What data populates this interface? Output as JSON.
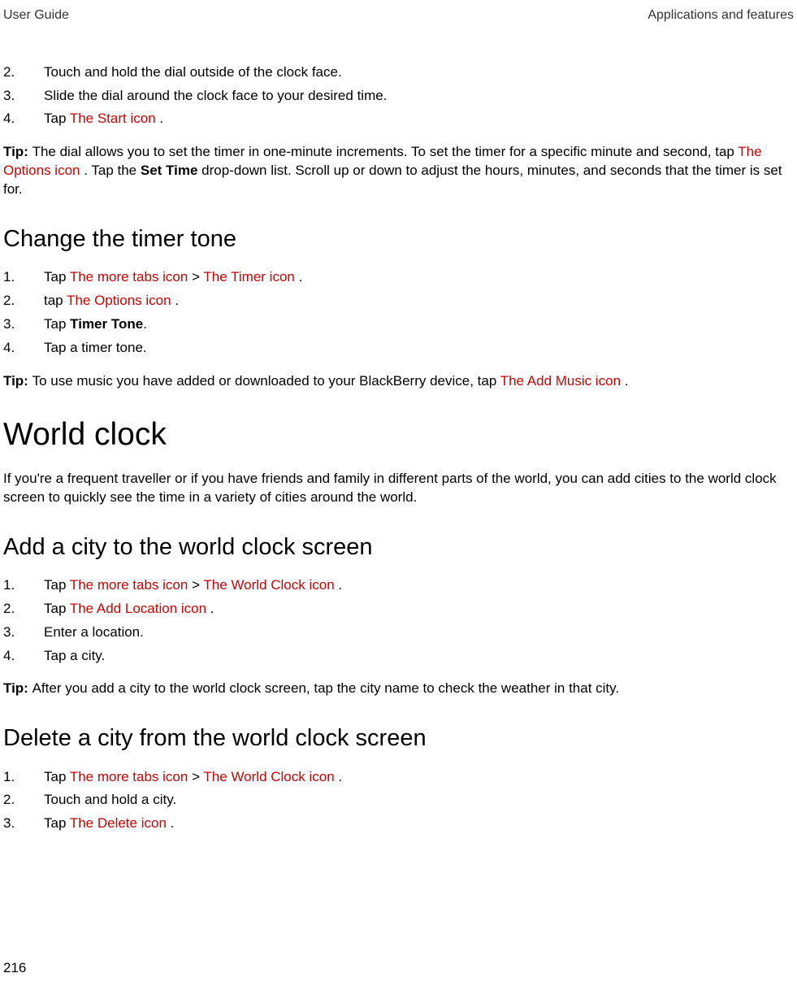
{
  "header": {
    "left": "User Guide",
    "right": "Applications and features"
  },
  "list1": {
    "i1": {
      "num": "2.",
      "text": "Touch and hold the dial outside of the clock face."
    },
    "i2": {
      "num": "3.",
      "text": "Slide the dial around the clock face to your desired time."
    },
    "i3": {
      "num": "4.",
      "pre": "Tap ",
      "icon": " The Start icon ",
      "post": "."
    }
  },
  "tip1": {
    "label": "Tip: ",
    "a": "The dial allows you to set the timer in one-minute increments. To set the timer for a specific minute and second, tap ",
    "icon": " The Options icon ",
    "b": ". Tap the ",
    "bold": "Set Time",
    "c": " drop-down list. Scroll up or down to adjust the hours, minutes, and seconds that the timer is set for."
  },
  "h_timer_tone": "Change the timer tone",
  "list2": {
    "i1": {
      "num": "1.",
      "pre": "Tap ",
      "icon1": " The more tabs icon ",
      "sep": " > ",
      "icon2": " The Timer icon ",
      "post": "."
    },
    "i2": {
      "num": "2.",
      "pre": "tap ",
      "icon": " The Options icon ",
      "post": "."
    },
    "i3": {
      "num": "3.",
      "pre": "Tap ",
      "bold": "Timer Tone",
      "post": "."
    },
    "i4": {
      "num": "4.",
      "text": "Tap a timer tone."
    }
  },
  "tip2": {
    "label": "Tip: ",
    "a": "To use music you have added or downloaded to your BlackBerry device, tap ",
    "icon": " The Add Music icon ",
    "b": "."
  },
  "h_world_clock": "World clock",
  "wc_para": "If you're a frequent traveller or if you have friends and family in different parts of the world, you can add cities to the world clock screen to quickly see the time in a variety of cities around the world.",
  "h_add_city": "Add a city to the world clock screen",
  "list3": {
    "i1": {
      "num": "1.",
      "pre": "Tap ",
      "icon1": " The more tabs icon ",
      "sep": " > ",
      "icon2": " The World Clock icon ",
      "post": "."
    },
    "i2": {
      "num": "2.",
      "pre": "Tap ",
      "icon": " The Add Location icon ",
      "post": "."
    },
    "i3": {
      "num": "3.",
      "text": "Enter a location."
    },
    "i4": {
      "num": "4.",
      "text": "Tap a city."
    }
  },
  "tip3": {
    "label": "Tip: ",
    "a": "After you add a city to the world clock screen, tap the city name to check the weather in that city."
  },
  "h_delete_city": "Delete a city from the world clock screen",
  "list4": {
    "i1": {
      "num": "1.",
      "pre": "Tap ",
      "icon1": " The more tabs icon ",
      "sep": " > ",
      "icon2": " The World Clock icon ",
      "post": "."
    },
    "i2": {
      "num": "2.",
      "text": "Touch and hold a city."
    },
    "i3": {
      "num": "3.",
      "pre": "Tap ",
      "icon": " The Delete icon ",
      "post": "."
    }
  },
  "pagenum": "216"
}
